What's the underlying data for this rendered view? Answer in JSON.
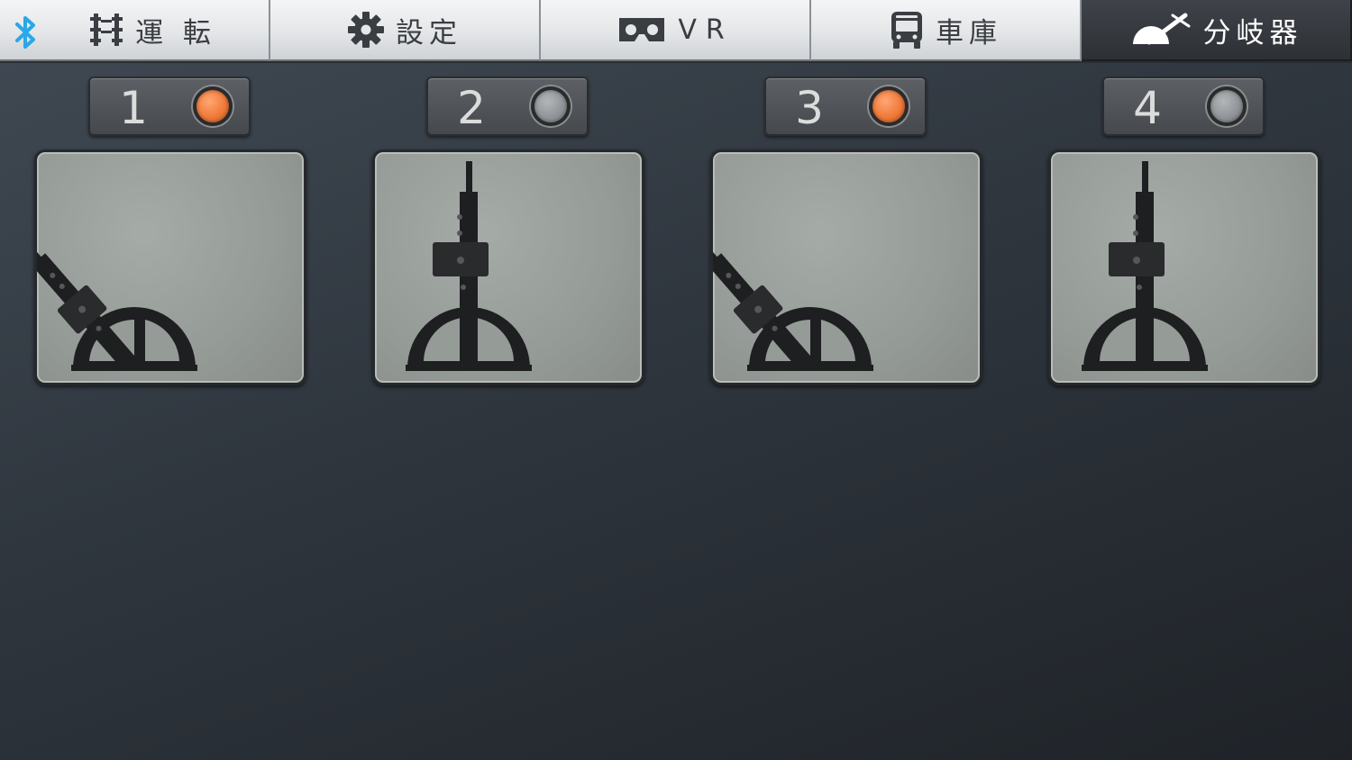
{
  "header": {
    "bluetooth_icon": "bluetooth-icon",
    "tabs": [
      {
        "label": "運 転",
        "icon": "track-icon",
        "active": false
      },
      {
        "label": "設定",
        "icon": "gear-icon",
        "active": false
      },
      {
        "label": "VR",
        "icon": "vr-headset-icon",
        "active": false
      },
      {
        "label": "車庫",
        "icon": "bus-icon",
        "active": false
      },
      {
        "label": "分岐器",
        "icon": "turnout-icon",
        "active": true
      }
    ]
  },
  "colors": {
    "indicator_on": "#f07a3a",
    "indicator_off": "#8e9296",
    "bluetooth": "#2aa8e8"
  },
  "switches": [
    {
      "number": "1",
      "indicator": "on",
      "lever_position": "diverging"
    },
    {
      "number": "2",
      "indicator": "off",
      "lever_position": "straight"
    },
    {
      "number": "3",
      "indicator": "on",
      "lever_position": "diverging"
    },
    {
      "number": "4",
      "indicator": "off",
      "lever_position": "straight"
    }
  ]
}
